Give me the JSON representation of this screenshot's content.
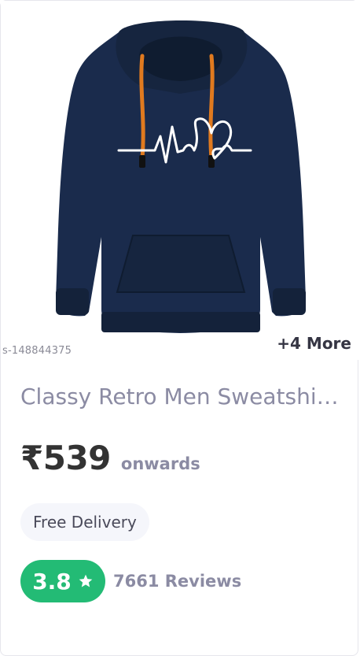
{
  "product": {
    "image_alt": "Navy blue hoodie with heartbeat print",
    "catalog_id": "s-148844375",
    "more_label": "+4 More",
    "title": "Classy Retro Men Sweatshirts",
    "price": "₹539",
    "price_suffix": "onwards",
    "delivery_label": "Free Delivery",
    "rating": "3.8",
    "reviews": "7661 Reviews"
  },
  "colors": {
    "hoodie": "#1a2b4c",
    "drawstring": "#e07a1f",
    "rating_badge": "#23bb75",
    "title_text": "#8b8ba3"
  },
  "icons": [
    "star-icon"
  ]
}
